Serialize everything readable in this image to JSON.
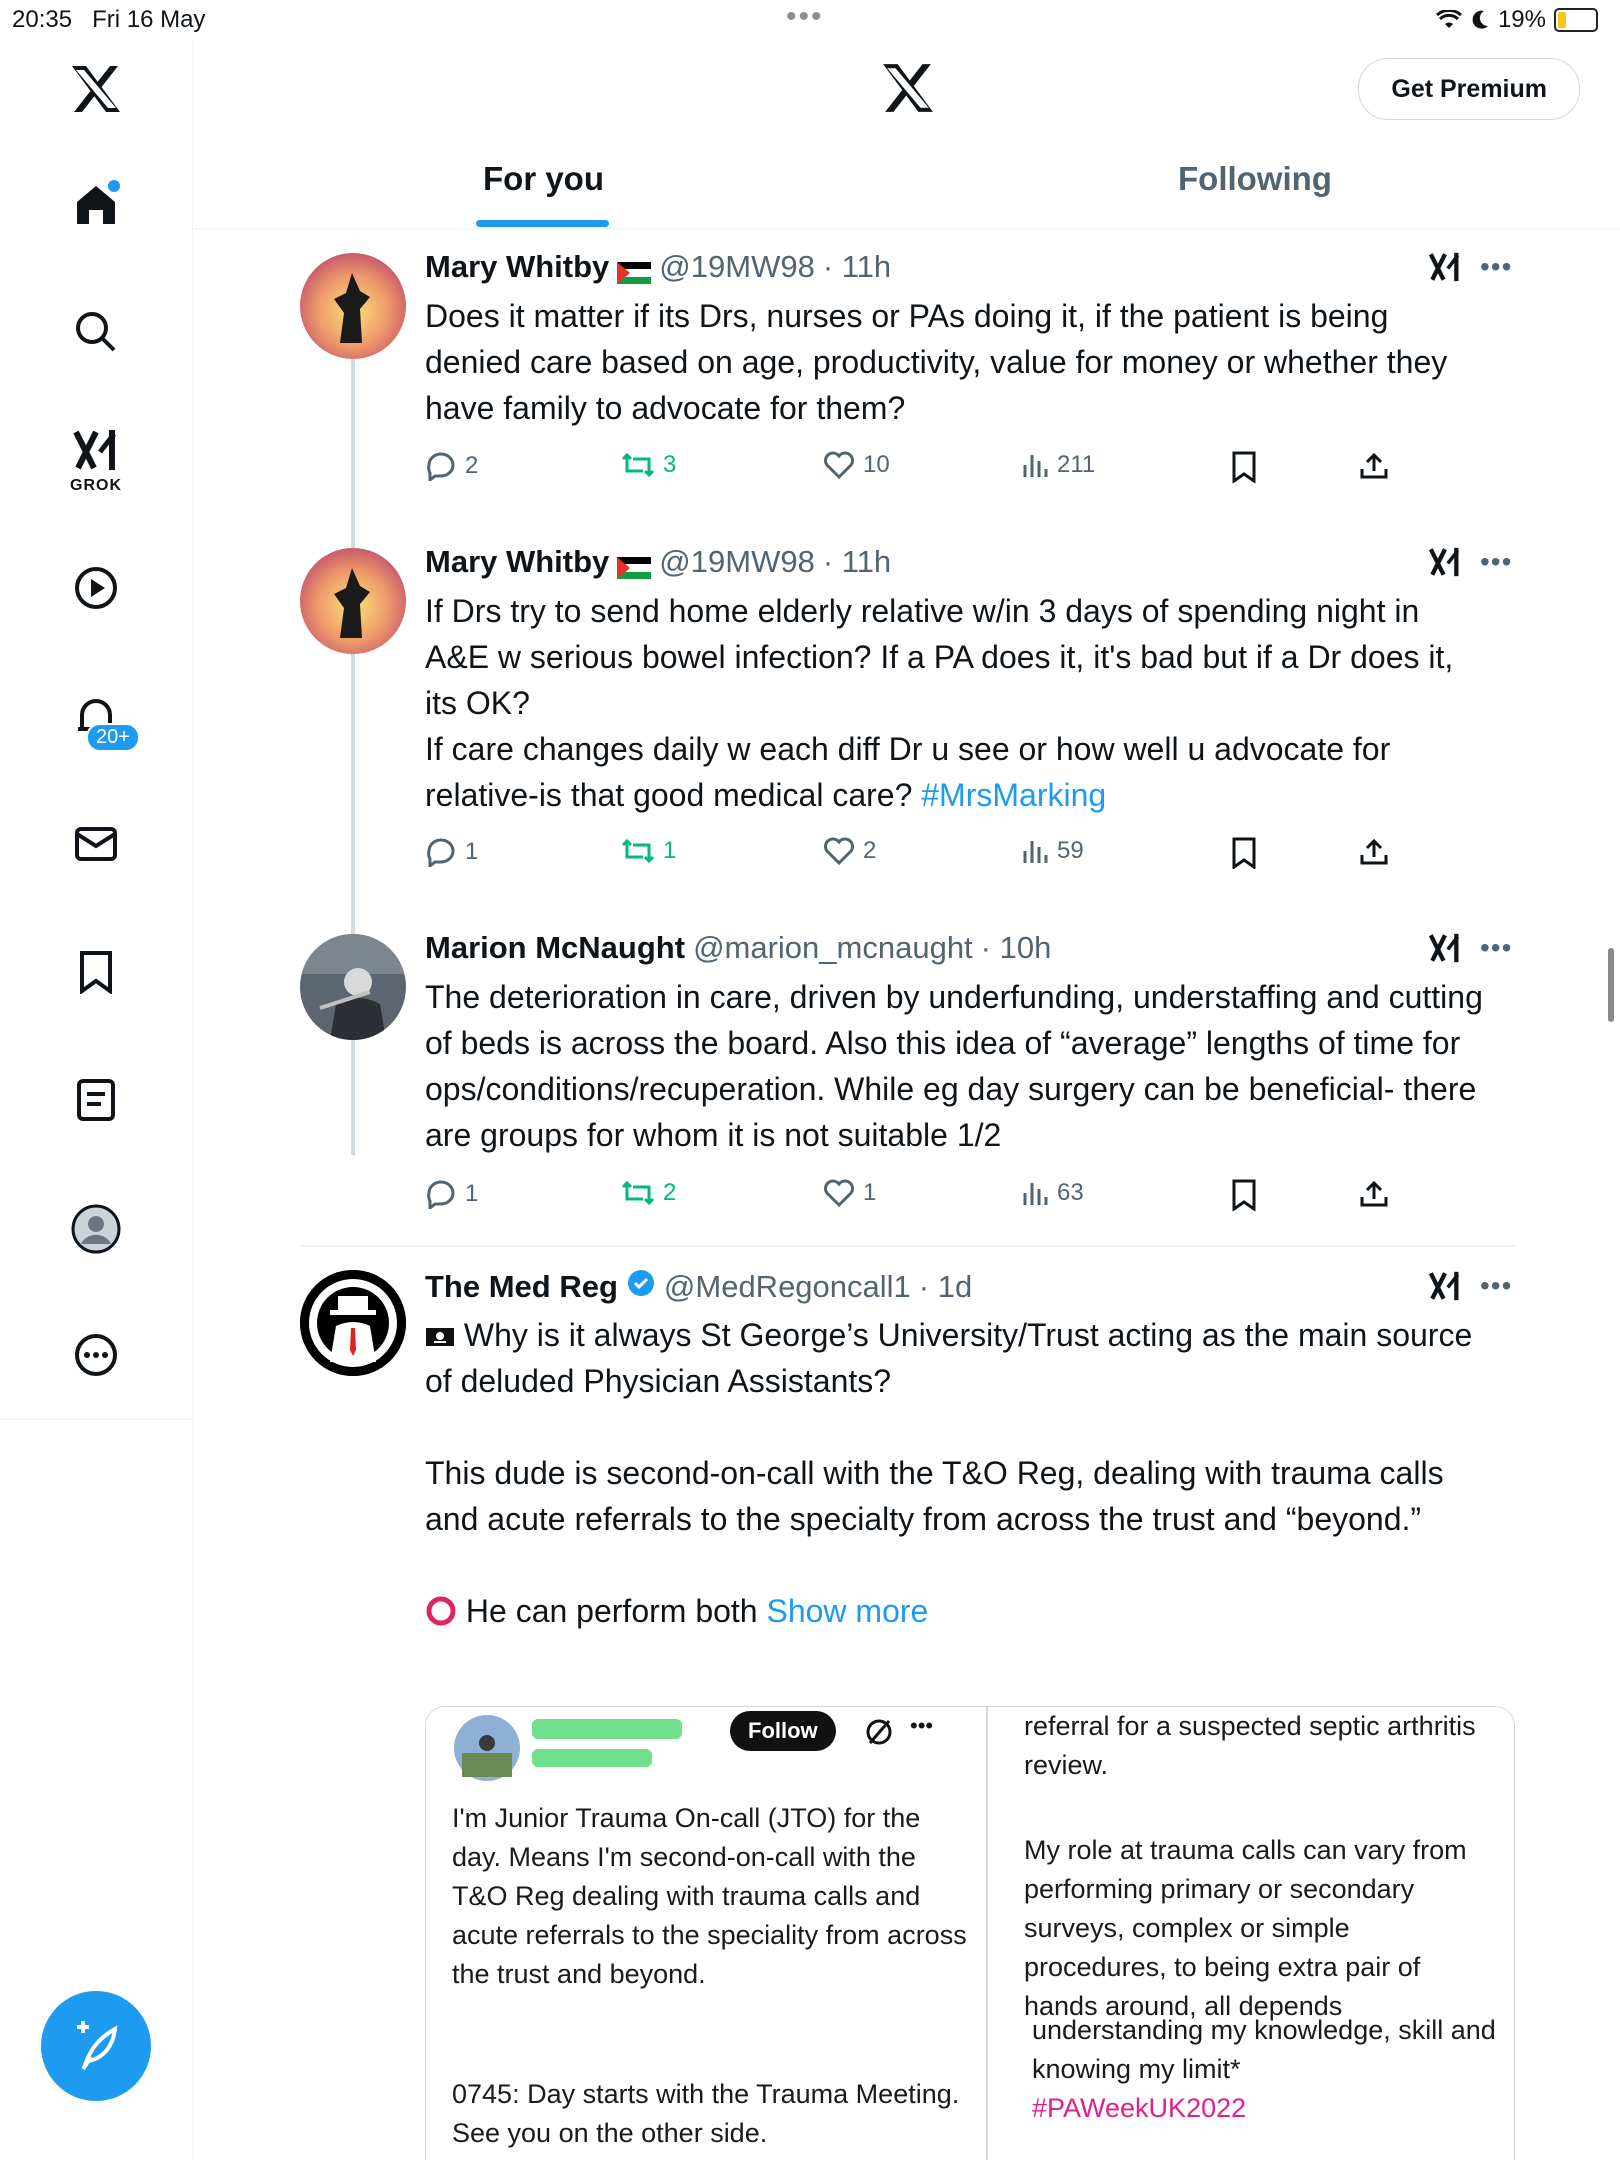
{
  "status_bar": {
    "time": "20:35",
    "date": "Fri 16 May",
    "battery": "19%"
  },
  "header": {
    "premium_label": "Get Premium",
    "tabs": [
      "For you",
      "Following"
    ],
    "active_tab": 0
  },
  "sidebar": {
    "grok_label": "GROK",
    "notifications_badge": "20+"
  },
  "colors": {
    "accent": "#1d9bf0",
    "retweet": "#00ba7c",
    "muted": "#536471"
  },
  "tweets": [
    {
      "name": "Mary Whitby",
      "handle": "@19MW98",
      "time": "· 11h",
      "text": "Does it matter if its Drs, nurses or PAs doing it, if the patient is being denied care based on age, productivity, value for money or whether they have family to advocate for them?",
      "replies": "2",
      "retweets": "3",
      "likes": "10",
      "views": "211"
    },
    {
      "name": "Mary Whitby",
      "handle": "@19MW98",
      "time": "· 11h",
      "text_lines": [
        "If Drs try to send home elderly relative w/in 3 days of spending night in A&E w serious bowel infection? If a PA does it, it's bad but if a Dr does it, its OK?",
        "If care changes daily w each diff Dr u see or how well u advocate for relative-is that good medical care?"
      ],
      "hashtag": "#MrsMarking",
      "replies": "1",
      "retweets": "1",
      "likes": "2",
      "views": "59"
    },
    {
      "name": "Marion McNaught",
      "handle": "@marion_mcnaught",
      "time": "· 10h",
      "text": "The deterioration in care, driven by underfunding, understaffing and cutting of beds is across the board. Also this idea of “average” lengths of time for ops/conditions/recuperation. While eg day surgery can be beneficial- there are groups for whom it is not suitable 1/2",
      "replies": "1",
      "retweets": "2",
      "likes": "1",
      "views": "63"
    },
    {
      "name": "The Med Reg",
      "handle": "@MedRegoncall1",
      "time": "· 1d",
      "para1": "Why is it always St George’s University/Trust acting as the main source of deluded Physician Assistants?",
      "para2": "This dude is second-on-call with the T&O Reg, dealing with trauma calls and acute referrals to the specialty from across the trust and “beyond.”",
      "para3": "He can perform both",
      "show_more": "Show more"
    }
  ],
  "media": {
    "follow_label": "Follow",
    "left_p1": "I'm Junior Trauma On-call (JTO) for the day. Means I'm second-on-call with the T&O Reg dealing with trauma calls and acute referrals to the speciality from across the trust and beyond.",
    "left_p2": "0745: Day starts with the Trauma Meeting. See you on the other side.",
    "right_p1": "referral for a suspected septic arthritis review.",
    "right_p2": "My role at trauma calls can vary from performing primary or secondary surveys, complex or simple procedures, to being extra pair of hands around, all depends",
    "right_p3": "understanding my knowledge, skill and knowing my limit*",
    "right_tag": "#PAWeekUK2022"
  }
}
